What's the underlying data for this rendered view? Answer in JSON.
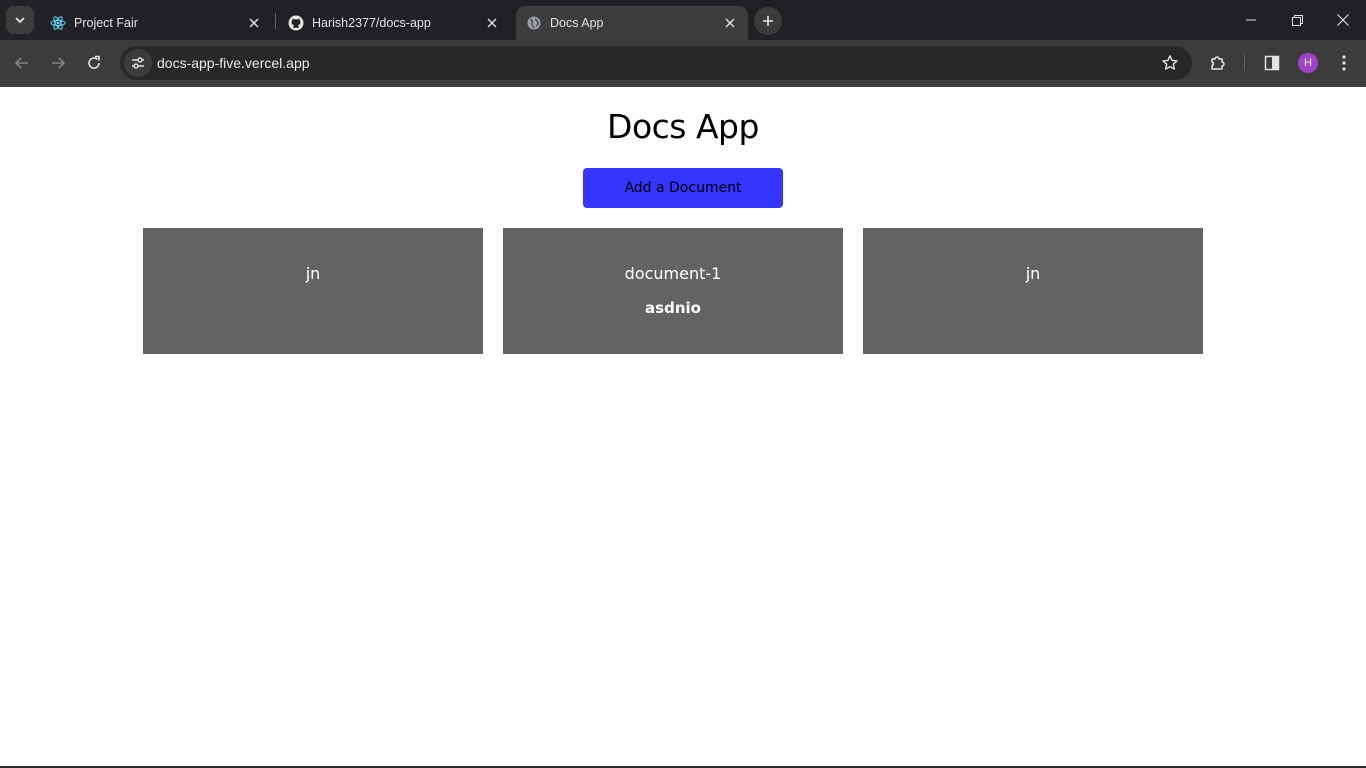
{
  "browser": {
    "tabs": [
      {
        "title": "Project Fair",
        "favicon": "react-icon",
        "active": false
      },
      {
        "title": "Harish2377/docs-app",
        "favicon": "github-icon",
        "active": false
      },
      {
        "title": "Docs App",
        "favicon": "globe-icon",
        "active": true
      }
    ],
    "url": "docs-app-five.vercel.app",
    "profile_initial": "H",
    "colors": {
      "tabbar": "#202124",
      "toolbar": "#3c3c3c",
      "omnibox": "#282828",
      "profile": "#a142c9"
    }
  },
  "app": {
    "title": "Docs App",
    "add_button_label": "Add a Document",
    "accent_color": "#3535ff",
    "card_color": "#636363",
    "documents": [
      {
        "title": "jn",
        "body": ""
      },
      {
        "title": "document-1",
        "body": "asdnio"
      },
      {
        "title": "jn",
        "body": ""
      }
    ]
  }
}
